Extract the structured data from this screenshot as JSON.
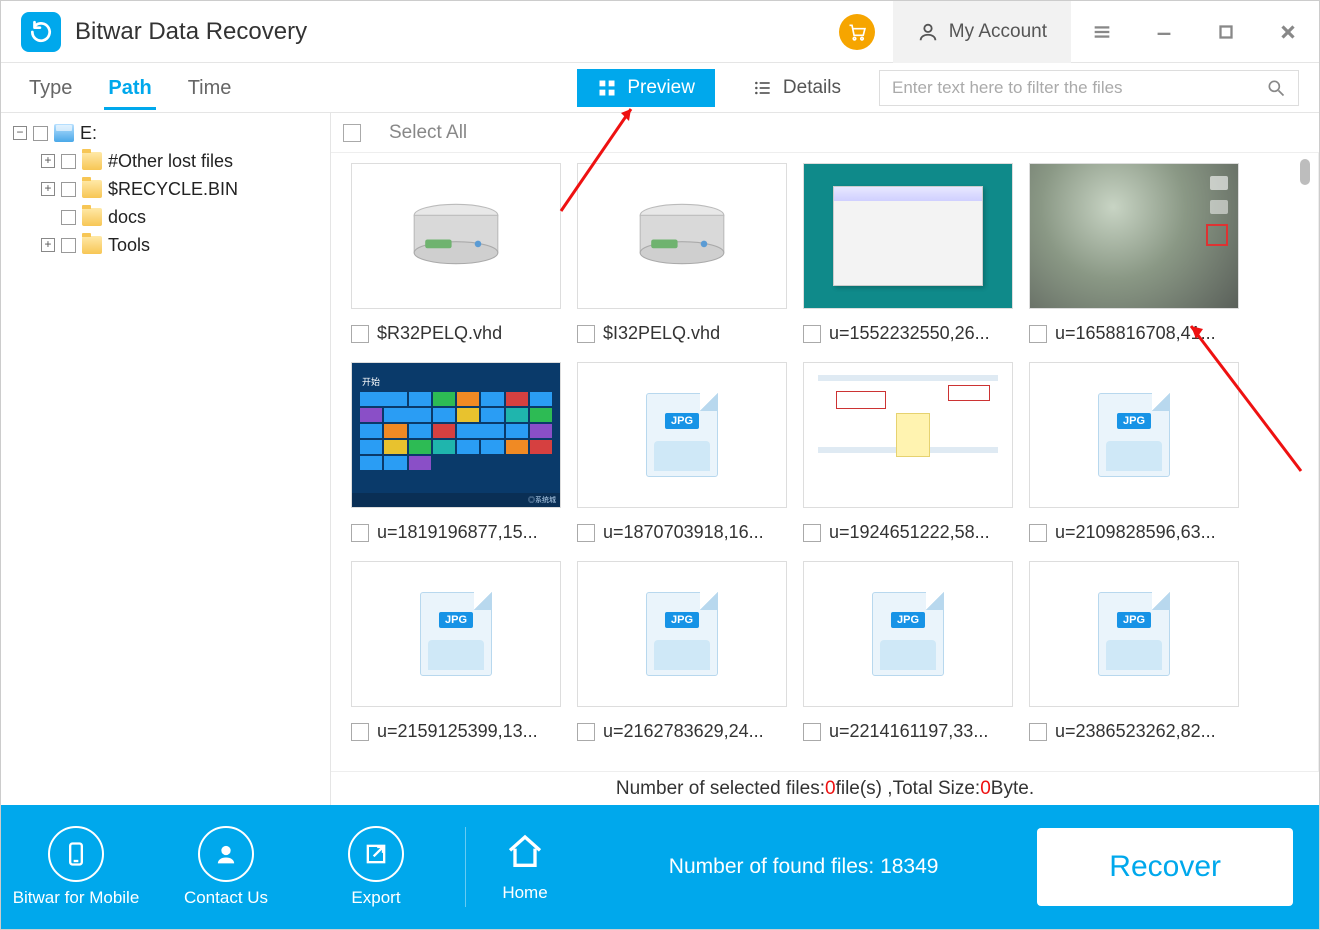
{
  "app": {
    "title": "Bitwar Data Recovery"
  },
  "header": {
    "account_label": "My Account"
  },
  "tabs": {
    "type": "Type",
    "path": "Path",
    "time": "Time"
  },
  "view": {
    "preview": "Preview",
    "details": "Details"
  },
  "search": {
    "placeholder": "Enter text here to filter the files"
  },
  "tree": {
    "root": "E:",
    "children": [
      {
        "label": "#Other lost files",
        "expandable": true
      },
      {
        "label": "$RECYCLE.BIN",
        "expandable": true
      },
      {
        "label": "docs",
        "expandable": false
      },
      {
        "label": "Tools",
        "expandable": true
      }
    ]
  },
  "select_all": "Select All",
  "files": [
    {
      "name": "$R32PELQ.vhd",
      "thumb": "hdd"
    },
    {
      "name": "$I32PELQ.vhd",
      "thumb": "hdd"
    },
    {
      "name": "u=1552232550,26...",
      "thumb": "screenshot-teal"
    },
    {
      "name": "u=1658816708,41...",
      "thumb": "blur"
    },
    {
      "name": "u=1819196877,15...",
      "thumb": "metro"
    },
    {
      "name": "u=1870703918,16...",
      "thumb": "jpg"
    },
    {
      "name": "u=1924651222,58...",
      "thumb": "diagram"
    },
    {
      "name": "u=2109828596,63...",
      "thumb": "jpg"
    },
    {
      "name": "u=2159125399,13...",
      "thumb": "jpg"
    },
    {
      "name": "u=2162783629,24...",
      "thumb": "jpg"
    },
    {
      "name": "u=2214161197,33...",
      "thumb": "jpg"
    },
    {
      "name": "u=2386523262,82...",
      "thumb": "jpg"
    }
  ],
  "status": {
    "prefix": "Number of selected files: ",
    "count": "0",
    "mid": "file(s) ,Total Size: ",
    "size": "0",
    "suffix": "Byte.",
    "found_prefix": "Number of found files: ",
    "found": "18349"
  },
  "bottom": {
    "mobile": "Bitwar for Mobile",
    "contact": "Contact Us",
    "export": "Export",
    "home": "Home",
    "recover": "Recover"
  }
}
